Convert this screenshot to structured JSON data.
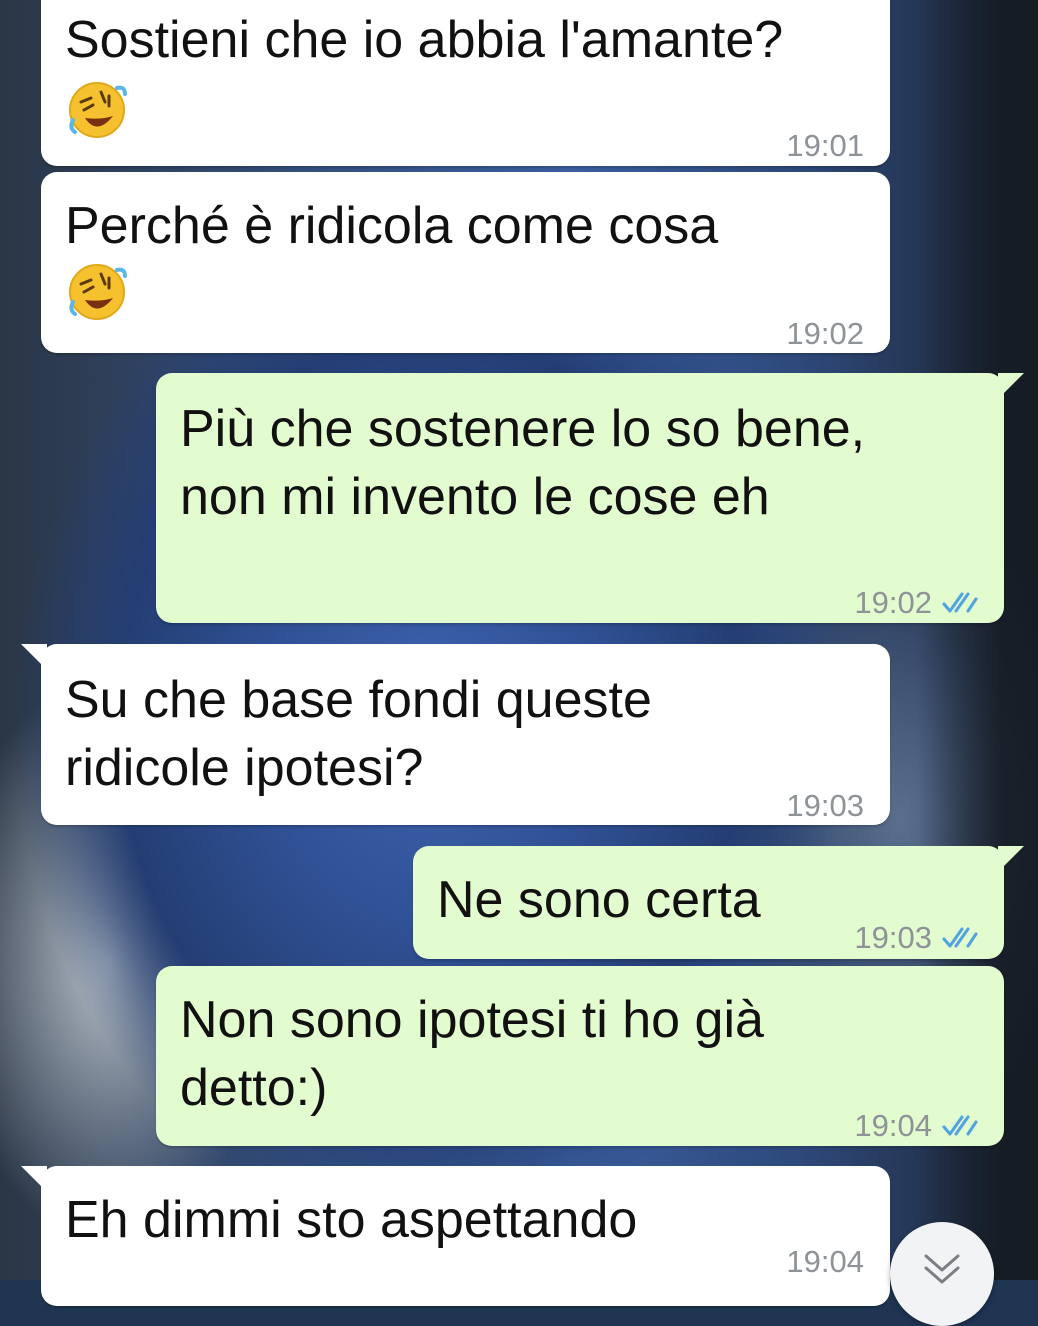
{
  "messages": [
    {
      "direction": "incoming",
      "text": "Sostieni che io abbia l'amante?",
      "emoji": "🤣",
      "emoji_icon": "rolling-on-floor-laughing-icon",
      "time": "19:01"
    },
    {
      "direction": "incoming",
      "text": "Perché è ridicola come cosa",
      "emoji": "🤣",
      "emoji_icon": "rolling-on-floor-laughing-icon",
      "time": "19:02"
    },
    {
      "direction": "outgoing",
      "text": "Più che sostenere lo so bene,\nnon mi invento le cose eh",
      "time": "19:02",
      "status": "read"
    },
    {
      "direction": "incoming",
      "text": "Su che base fondi queste\nridicole ipotesi?",
      "time": "19:03"
    },
    {
      "direction": "outgoing",
      "text": "Ne sono certa",
      "time": "19:03",
      "status": "read"
    },
    {
      "direction": "outgoing",
      "text": "Non sono ipotesi ti ho già\ndetto:)",
      "time": "19:04",
      "status": "read"
    },
    {
      "direction": "incoming",
      "text": "Eh dimmi sto aspettando",
      "time": "19:04"
    }
  ],
  "scroll_to_bottom": {
    "icon": "double-chevron-down-icon"
  },
  "colors": {
    "incoming_bubble": "#ffffff",
    "outgoing_bubble": "#e2fbcf",
    "timestamp": "#8e9398",
    "read_ticks": "#4fa3e0",
    "message_text": "#111111"
  }
}
